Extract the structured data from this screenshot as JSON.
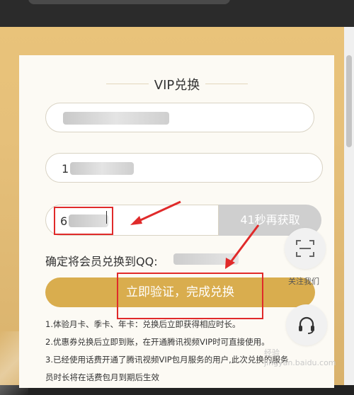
{
  "page": {
    "title": "VIP兑换"
  },
  "form": {
    "phone_prefix": "1",
    "code_prefix": "6",
    "resend_label": "41秒再获取",
    "confirm_label": "确定将会员兑换到QQ:",
    "submit_label": "立即验证，完成兑换"
  },
  "notes": [
    "1.体验月卡、季卡、年卡：兑换后立即获得相应时长。",
    "2.优惠券兑换后立即到账，在开通腾讯视频VIP时可直接使用。",
    "3.已经使用话费开通了腾讯视频VIP包月服务的用户,此次兑换的服务",
    "员时长将在话费包月到期后生效"
  ],
  "side": {
    "follow_label": "关注我们"
  },
  "watermark": {
    "line1": "经验",
    "line2": "jingyan.baidu.com"
  },
  "colors": {
    "accent_gold": "#d9ad4e",
    "annotation_red": "#e02a2a",
    "resend_gray": "#cfcfcf"
  }
}
